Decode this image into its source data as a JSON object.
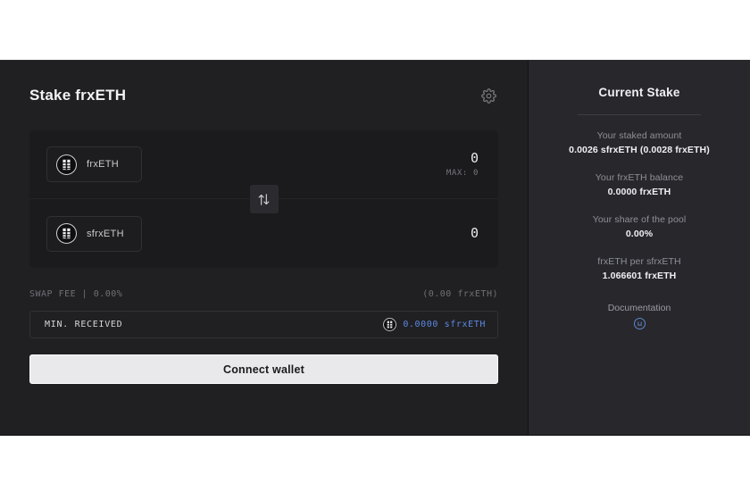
{
  "stake_panel": {
    "title": "Stake frxETH",
    "settings_icon": "gear-icon",
    "swap_toggle_icon": "swap-vertical-arrows-icon",
    "from": {
      "token": "frxETH",
      "token_icon": "frxeth-token-icon",
      "amount": "0",
      "max_label": "MAX: 0"
    },
    "to": {
      "token": "sfrxETH",
      "token_icon": "sfrxeth-token-icon",
      "amount": "0"
    },
    "fee": {
      "label": "SWAP FEE | 0.00%",
      "value": "(0.00 frxETH)"
    },
    "min_received": {
      "label": "MIN. RECEIVED",
      "icon": "sfrxeth-token-icon",
      "value": "0.0000 sfrxETH",
      "value_color": "#5c88e0"
    },
    "connect_button": "Connect wallet"
  },
  "side_panel": {
    "title": "Current Stake",
    "stats": [
      {
        "label": "Your staked amount",
        "value": "0.0026 sfrxETH (0.0028 frxETH)"
      },
      {
        "label": "Your frxETH balance",
        "value": "0.0000 frxETH"
      },
      {
        "label": "Your share of the pool",
        "value": "0.00%"
      },
      {
        "label": "frxETH per sfrxETH",
        "value": "1.066601 frxETH"
      }
    ],
    "documentation": {
      "label": "Documentation",
      "icon": "info-circle-icon",
      "icon_color": "#5f86cf"
    }
  },
  "theme": {
    "page_background": "#ffffff",
    "card_background": "#202023",
    "side_background": "#28282c",
    "swap_background": "#1b1b1e",
    "accent_blue": "#5c88e0",
    "text_primary": "#f0f0f3",
    "text_muted": "#8f8f97"
  }
}
